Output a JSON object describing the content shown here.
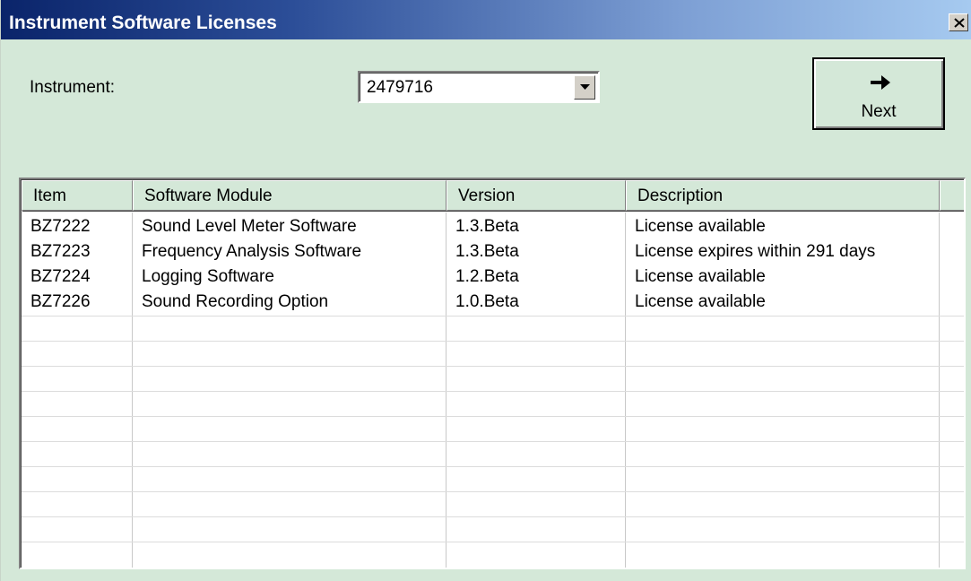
{
  "window": {
    "title": "Instrument Software Licenses",
    "close_icon": "close-icon"
  },
  "instrument": {
    "label": "Instrument:",
    "selected": "2479716"
  },
  "next_button": {
    "label": "Next",
    "icon": "arrow-right-icon"
  },
  "table": {
    "columns": [
      "Item",
      "Software Module",
      "Version",
      "Description"
    ],
    "rows": [
      {
        "item": "BZ7222",
        "module": "Sound Level Meter Software",
        "version": "1.3.Beta",
        "description": "License available"
      },
      {
        "item": "BZ7223",
        "module": "Frequency Analysis Software",
        "version": "1.3.Beta",
        "description": "License expires within 291 days"
      },
      {
        "item": "BZ7224",
        "module": "Logging Software",
        "version": "1.2.Beta",
        "description": "License available"
      },
      {
        "item": "BZ7226",
        "module": "Sound Recording Option",
        "version": "1.0.Beta",
        "description": "License available"
      }
    ]
  },
  "colors": {
    "background": "#d4e8d8",
    "title_gradient_start": "#0a246a",
    "title_gradient_end": "#a6caf0"
  }
}
